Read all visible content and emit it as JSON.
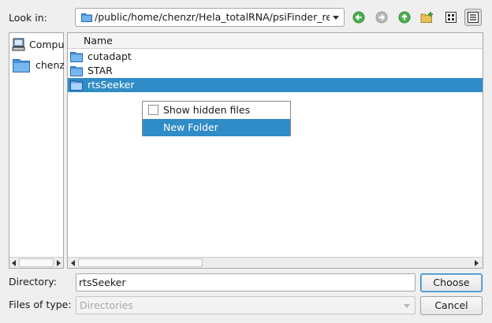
{
  "look_in": {
    "label": "Look in:",
    "path": "/public/home/chenzr/Hela_totalRNA/psiFinder_res"
  },
  "toolbar": {
    "buttons": [
      {
        "name": "back-button",
        "icon": "arrow-left-icon",
        "color": "#4caf50"
      },
      {
        "name": "forward-button",
        "icon": "arrow-right-icon",
        "color": "#a0a0a0"
      },
      {
        "name": "parent-dir-button",
        "icon": "arrow-up-icon",
        "color": "#4caf50"
      },
      {
        "name": "new-folder-button",
        "icon": "new-folder-icon",
        "color": "#d8b04a"
      },
      {
        "name": "list-view-button",
        "icon": "grid-icon"
      },
      {
        "name": "detail-view-button",
        "icon": "detail-list-icon"
      }
    ]
  },
  "sidebar": {
    "items": [
      {
        "label": "Computer",
        "icon": "computer-icon"
      },
      {
        "label": "chenzr",
        "icon": "folder-icon"
      }
    ]
  },
  "file_list": {
    "column_header": "Name",
    "rows": [
      {
        "name": "cutadapt",
        "selected": false
      },
      {
        "name": "STAR",
        "selected": false
      },
      {
        "name": "rtsSeeker",
        "selected": true
      }
    ]
  },
  "context_menu": {
    "show_hidden": "Show hidden files",
    "show_hidden_checked": false,
    "new_folder": "New Folder"
  },
  "form": {
    "directory_label": "Directory:",
    "directory_value": "rtsSeeker",
    "types_label": "Files of type:",
    "types_value": "Directories"
  },
  "buttons": {
    "choose": "Choose",
    "cancel": "Cancel"
  },
  "colors": {
    "selection": "#308cc6",
    "folder": "#4a90d9"
  }
}
